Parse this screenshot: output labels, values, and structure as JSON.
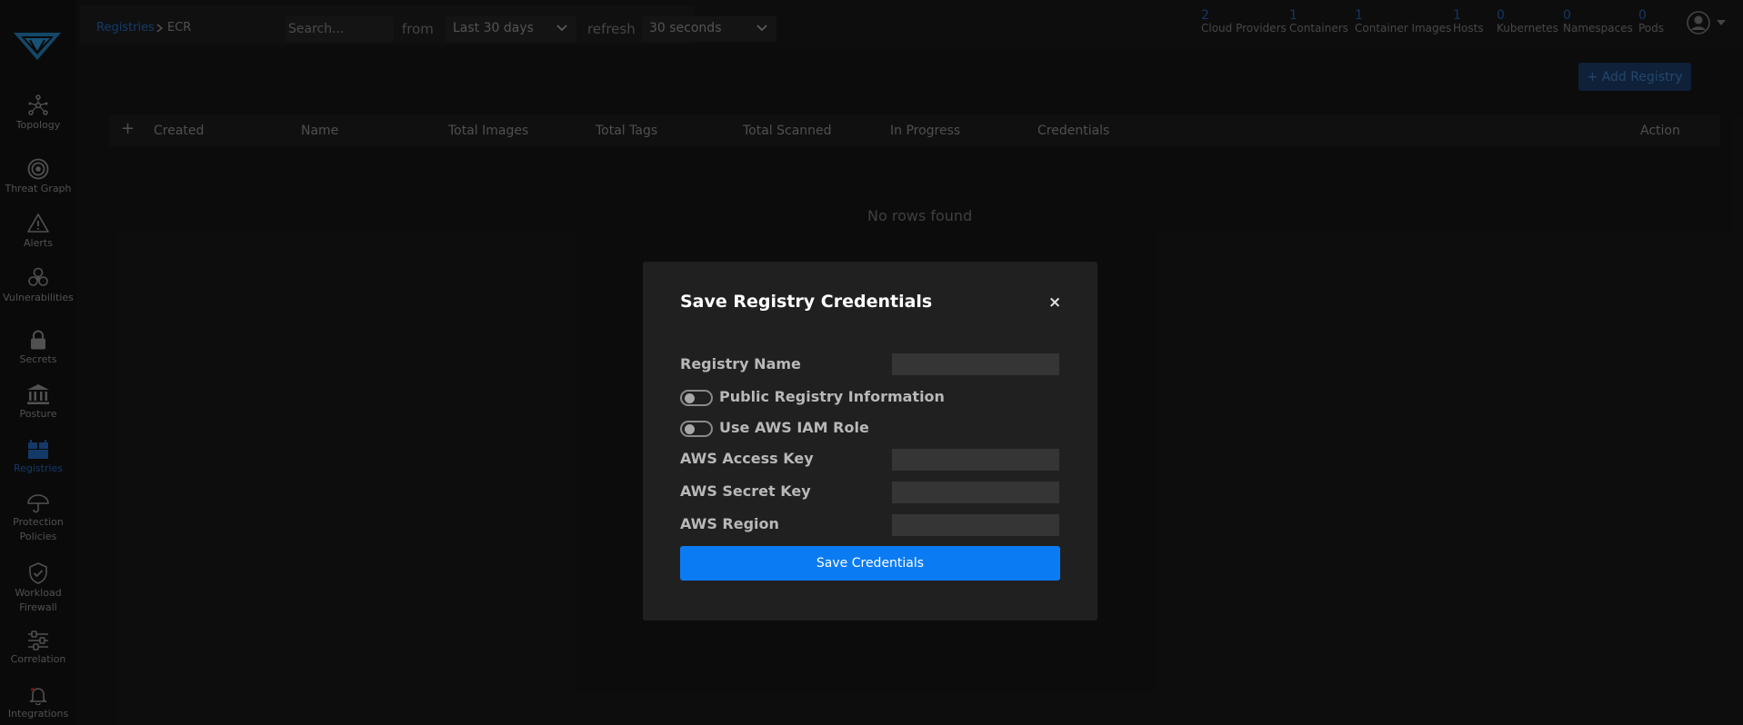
{
  "sidebar": {
    "items": [
      {
        "label": "Topology",
        "icon": "topology-icon"
      },
      {
        "label": "Threat Graph",
        "icon": "target-icon"
      },
      {
        "label": "Alerts",
        "icon": "warning-triangle-icon"
      },
      {
        "label": "Vulnerabilities",
        "icon": "biohazard-icon"
      },
      {
        "label": "Secrets",
        "icon": "lock-icon"
      },
      {
        "label": "Posture",
        "icon": "bank-icon"
      },
      {
        "label": "Registries",
        "icon": "registry-boxes-icon",
        "active": true
      },
      {
        "label": "Protection\nPolicies",
        "icon": "umbrella-icon"
      },
      {
        "label": "Workload\nFirewall",
        "icon": "shield-check-icon"
      },
      {
        "label": "Correlation",
        "icon": "sliders-icon"
      },
      {
        "label": "Integrations",
        "icon": "bell-icon"
      }
    ]
  },
  "topbar": {
    "breadcrumb": {
      "parent": "Registries",
      "current": "ECR"
    },
    "search_placeholder": "Search...",
    "from_label": "from",
    "range_value": "Last 30 days",
    "refresh_label": "refresh",
    "refresh_value": "30 seconds",
    "stats": [
      {
        "count": "2",
        "label": "Cloud Providers"
      },
      {
        "count": "1",
        "label": "Containers"
      },
      {
        "count": "1",
        "label": "Container Images"
      },
      {
        "count": "1",
        "label": "Hosts"
      },
      {
        "count": "0",
        "label": "Kubernetes"
      },
      {
        "count": "0",
        "label": "Namespaces"
      },
      {
        "count": "0",
        "label": "Pods"
      }
    ]
  },
  "main": {
    "add_button": "+ Add Registry",
    "table": {
      "expand_symbol": "+",
      "columns": [
        "Created",
        "Name",
        "Total Images",
        "Total Tags",
        "Total Scanned",
        "In Progress",
        "Credentials",
        "Action"
      ],
      "empty_text": "No rows found"
    }
  },
  "modal": {
    "title": "Save Registry Credentials",
    "close_symbol": "×",
    "fields": {
      "registry_name": {
        "label": "Registry Name",
        "value": ""
      },
      "public_registry": {
        "label": "Public Registry Information",
        "enabled": false
      },
      "use_iam_role": {
        "label": "Use AWS IAM Role",
        "enabled": false
      },
      "access_key": {
        "label": "AWS Access Key",
        "value": ""
      },
      "secret_key": {
        "label": "AWS Secret Key",
        "value": ""
      },
      "region": {
        "label": "AWS Region",
        "value": ""
      }
    },
    "submit_label": "Save Credentials"
  },
  "colors": {
    "accent": "#0a7bf3",
    "background": "#111111",
    "modal_bg": "#202020",
    "active_nav": "#1a4d8c"
  }
}
